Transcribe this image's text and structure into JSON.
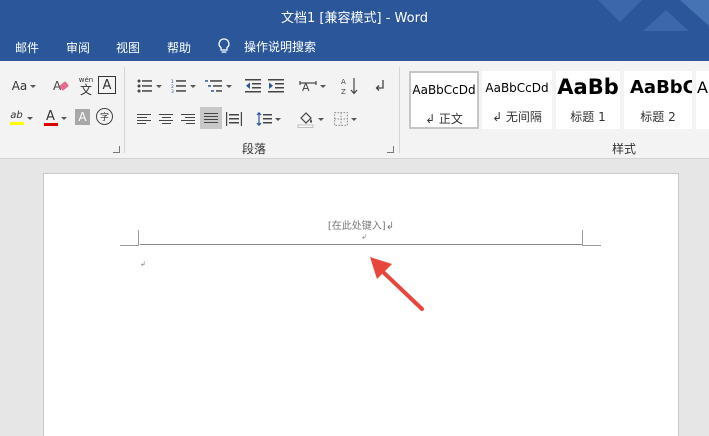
{
  "window": {
    "title": "文档1 [兼容模式]  -  Word"
  },
  "menu": {
    "items": [
      "邮件",
      "审阅",
      "视图",
      "帮助"
    ],
    "tell_me": "操作说明搜索"
  },
  "ribbon": {
    "font": {
      "size_btn": "Aa",
      "phonetic_top": "wén",
      "phonetic_bottom": "文",
      "border_char": "A",
      "highlight_label": "ab",
      "font_color_label": "A",
      "shade_label": "A",
      "enclose_label": "字",
      "highlight_color": "#ffff00",
      "font_color": "#e00000"
    },
    "paragraph": {
      "label": "段落",
      "sort_label": "A Z"
    },
    "styles": {
      "label": "样式",
      "items": [
        {
          "sample": "AaBbCcDd",
          "name": "↲ 正文"
        },
        {
          "sample": "AaBbCcDd",
          "name": "↲ 无间隔"
        },
        {
          "sample": "AaBb",
          "name": "标题 1"
        },
        {
          "sample": "AaBbC",
          "name": "标题 2"
        },
        {
          "sample": "A",
          "name": ""
        }
      ]
    }
  },
  "document": {
    "header_placeholder": "[在此处键入]↲",
    "para_mark": "↲"
  },
  "colors": {
    "titlebar": "#2b579a",
    "annotation_arrow": "#e8463b"
  }
}
